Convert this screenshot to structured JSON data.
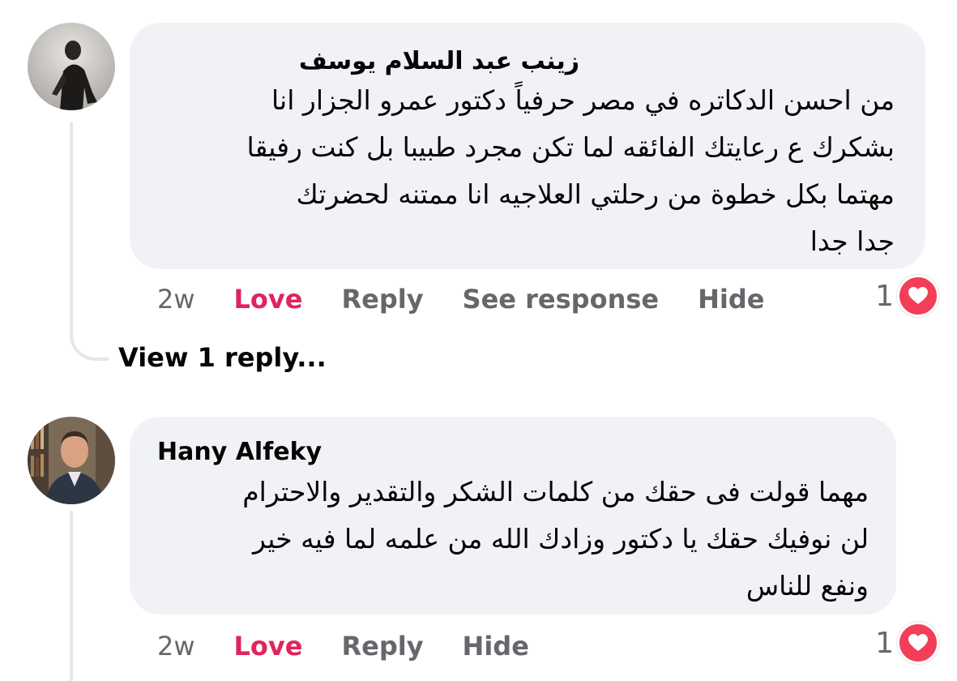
{
  "comments": [
    {
      "author": "زينب عبد السلام يوسف",
      "lines": [
        "من احسن الدكاتره في مصر حرفياً دكتور عمرو الجزار انا",
        "بشكرك ع رعايتك الفائقه لما تكن مجرد طبيبا بل كنت رفيقا",
        "مهتما بكل خطوة من رحلتي   العلاجيه انا ممتنه لحضرتك",
        "جدا جدا"
      ],
      "time": "2w",
      "actions": {
        "love": "Love",
        "reply": "Reply",
        "see_response": "See response",
        "hide": "Hide"
      },
      "reaction_count": "1",
      "reaction_icon": "heart-icon",
      "view_replies": "View 1 reply..."
    },
    {
      "author": "Hany Alfeky",
      "lines": [
        "مهما قولت فى حقك من كلمات الشكر والتقدير والاحترام",
        "لن نوفيك حقك يا دكتور وزادك الله من علمه لما فيه خير",
        "ونفع للناس"
      ],
      "time": "2w",
      "actions": {
        "love": "Love",
        "reply": "Reply",
        "hide": "Hide"
      },
      "reaction_count": "1",
      "reaction_icon": "heart-icon"
    }
  ],
  "colors": {
    "bubble": "#f0f2f5",
    "love_active": "#e0245e",
    "meta_text": "#65676b",
    "heart_badge": "#f33e58"
  }
}
